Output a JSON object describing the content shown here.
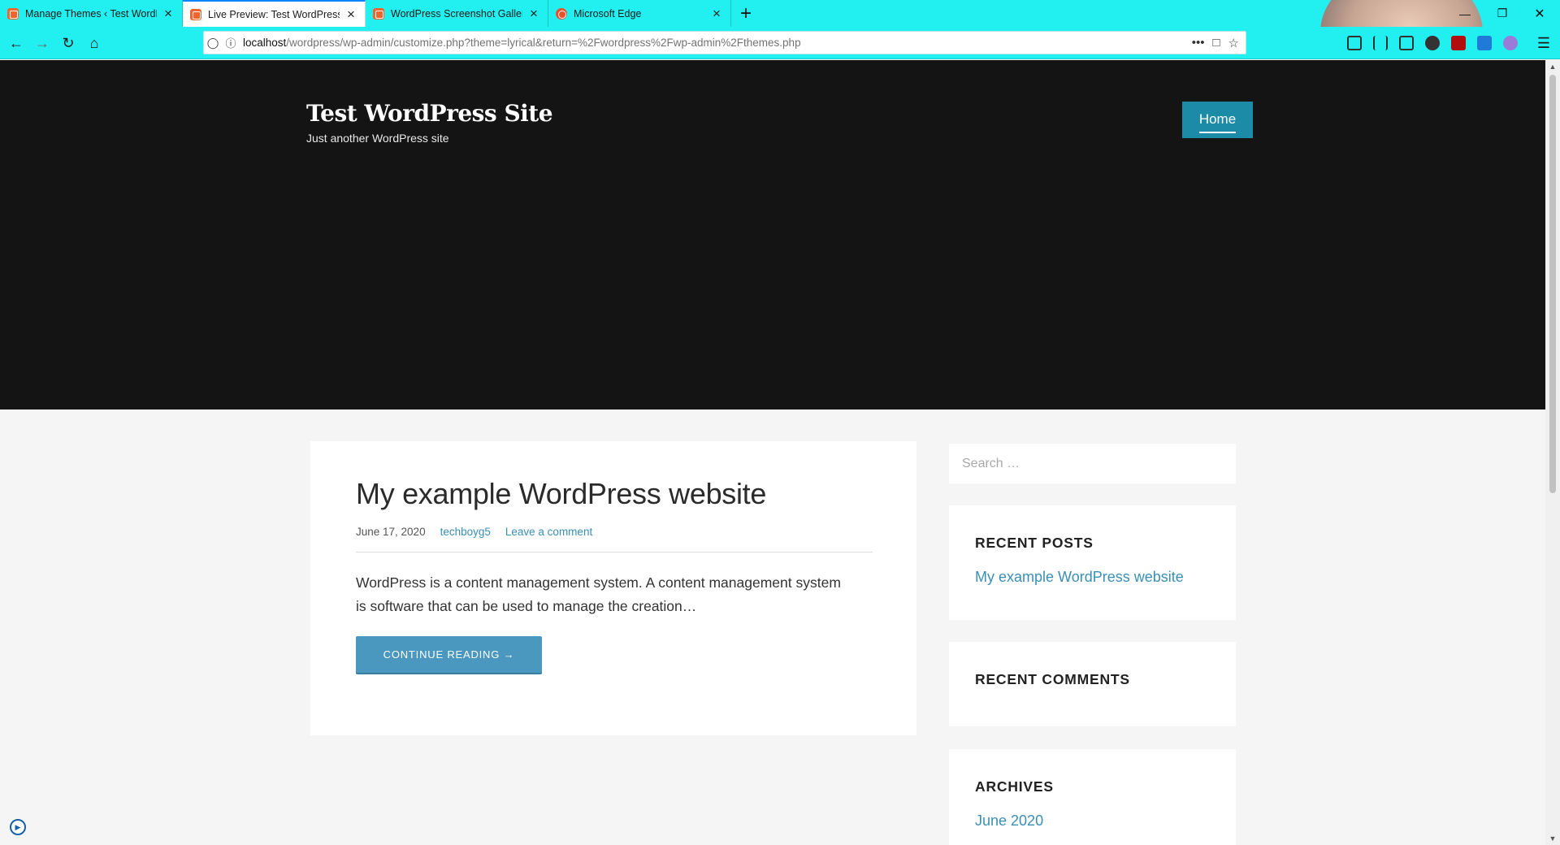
{
  "browser": {
    "tabs": [
      {
        "label": "Manage Themes ‹ Test WordPress",
        "icon": "xampp-favicon",
        "active": false
      },
      {
        "label": "Live Preview: Test WordPress Site",
        "icon": "xampp-favicon",
        "active": true
      },
      {
        "label": "WordPress Screenshot Gallery",
        "icon": "xampp-favicon",
        "active": false
      },
      {
        "label": "Microsoft Edge",
        "icon": "reddit-favicon",
        "active": false
      }
    ],
    "url_host": "localhost",
    "url_path": "/wordpress/wp-admin/customize.php?theme=lyrical&return=%2Fwordpress%2Fwp-admin%2Fthemes.php"
  },
  "site": {
    "title": "Test WordPress Site",
    "description": "Just another WordPress site",
    "nav_home": "Home"
  },
  "post": {
    "title": "My example WordPress website",
    "date": "June 17, 2020",
    "author": "techboyg5",
    "comment_link": "Leave a comment",
    "excerpt": "WordPress is a content management system. A content management system is software that can be used to manage the creation…",
    "more_label": "CONTINUE READING →"
  },
  "sidebar": {
    "search_placeholder": "Search …",
    "recent_posts_title": "RECENT POSTS",
    "recent_posts": [
      "My example WordPress website"
    ],
    "recent_comments_title": "RECENT COMMENTS",
    "archives_title": "ARCHIVES",
    "archives": [
      "June 2020"
    ]
  },
  "colors": {
    "chrome": "#22f0f0",
    "hero": "#141414",
    "accent": "#1b8ba8",
    "button": "#4a97c0",
    "link": "#3a8fb7"
  }
}
